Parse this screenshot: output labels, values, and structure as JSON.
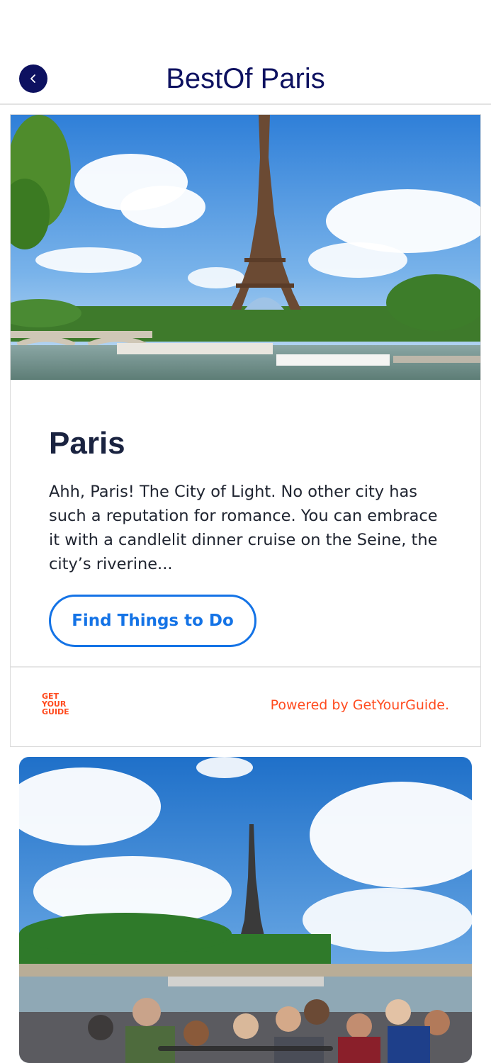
{
  "header": {
    "title": "BestOf Paris",
    "back_icon": "chevron-left-icon"
  },
  "destination": {
    "title": "Paris",
    "description": "Ahh, Paris! The City of Light. No other city has such a reputation for romance. You can embrace it with a candlelit dinner cruise on the Seine, the city’s riverine...",
    "button_label": "Find Things to Do",
    "logo_lines": [
      "GET",
      "YOUR",
      "GUIDE"
    ],
    "powered_by": "Powered by GetYourGuide."
  },
  "colors": {
    "primary_navy": "#0d1160",
    "button_blue": "#1473e6",
    "brand_orange": "#ff4b1f"
  }
}
